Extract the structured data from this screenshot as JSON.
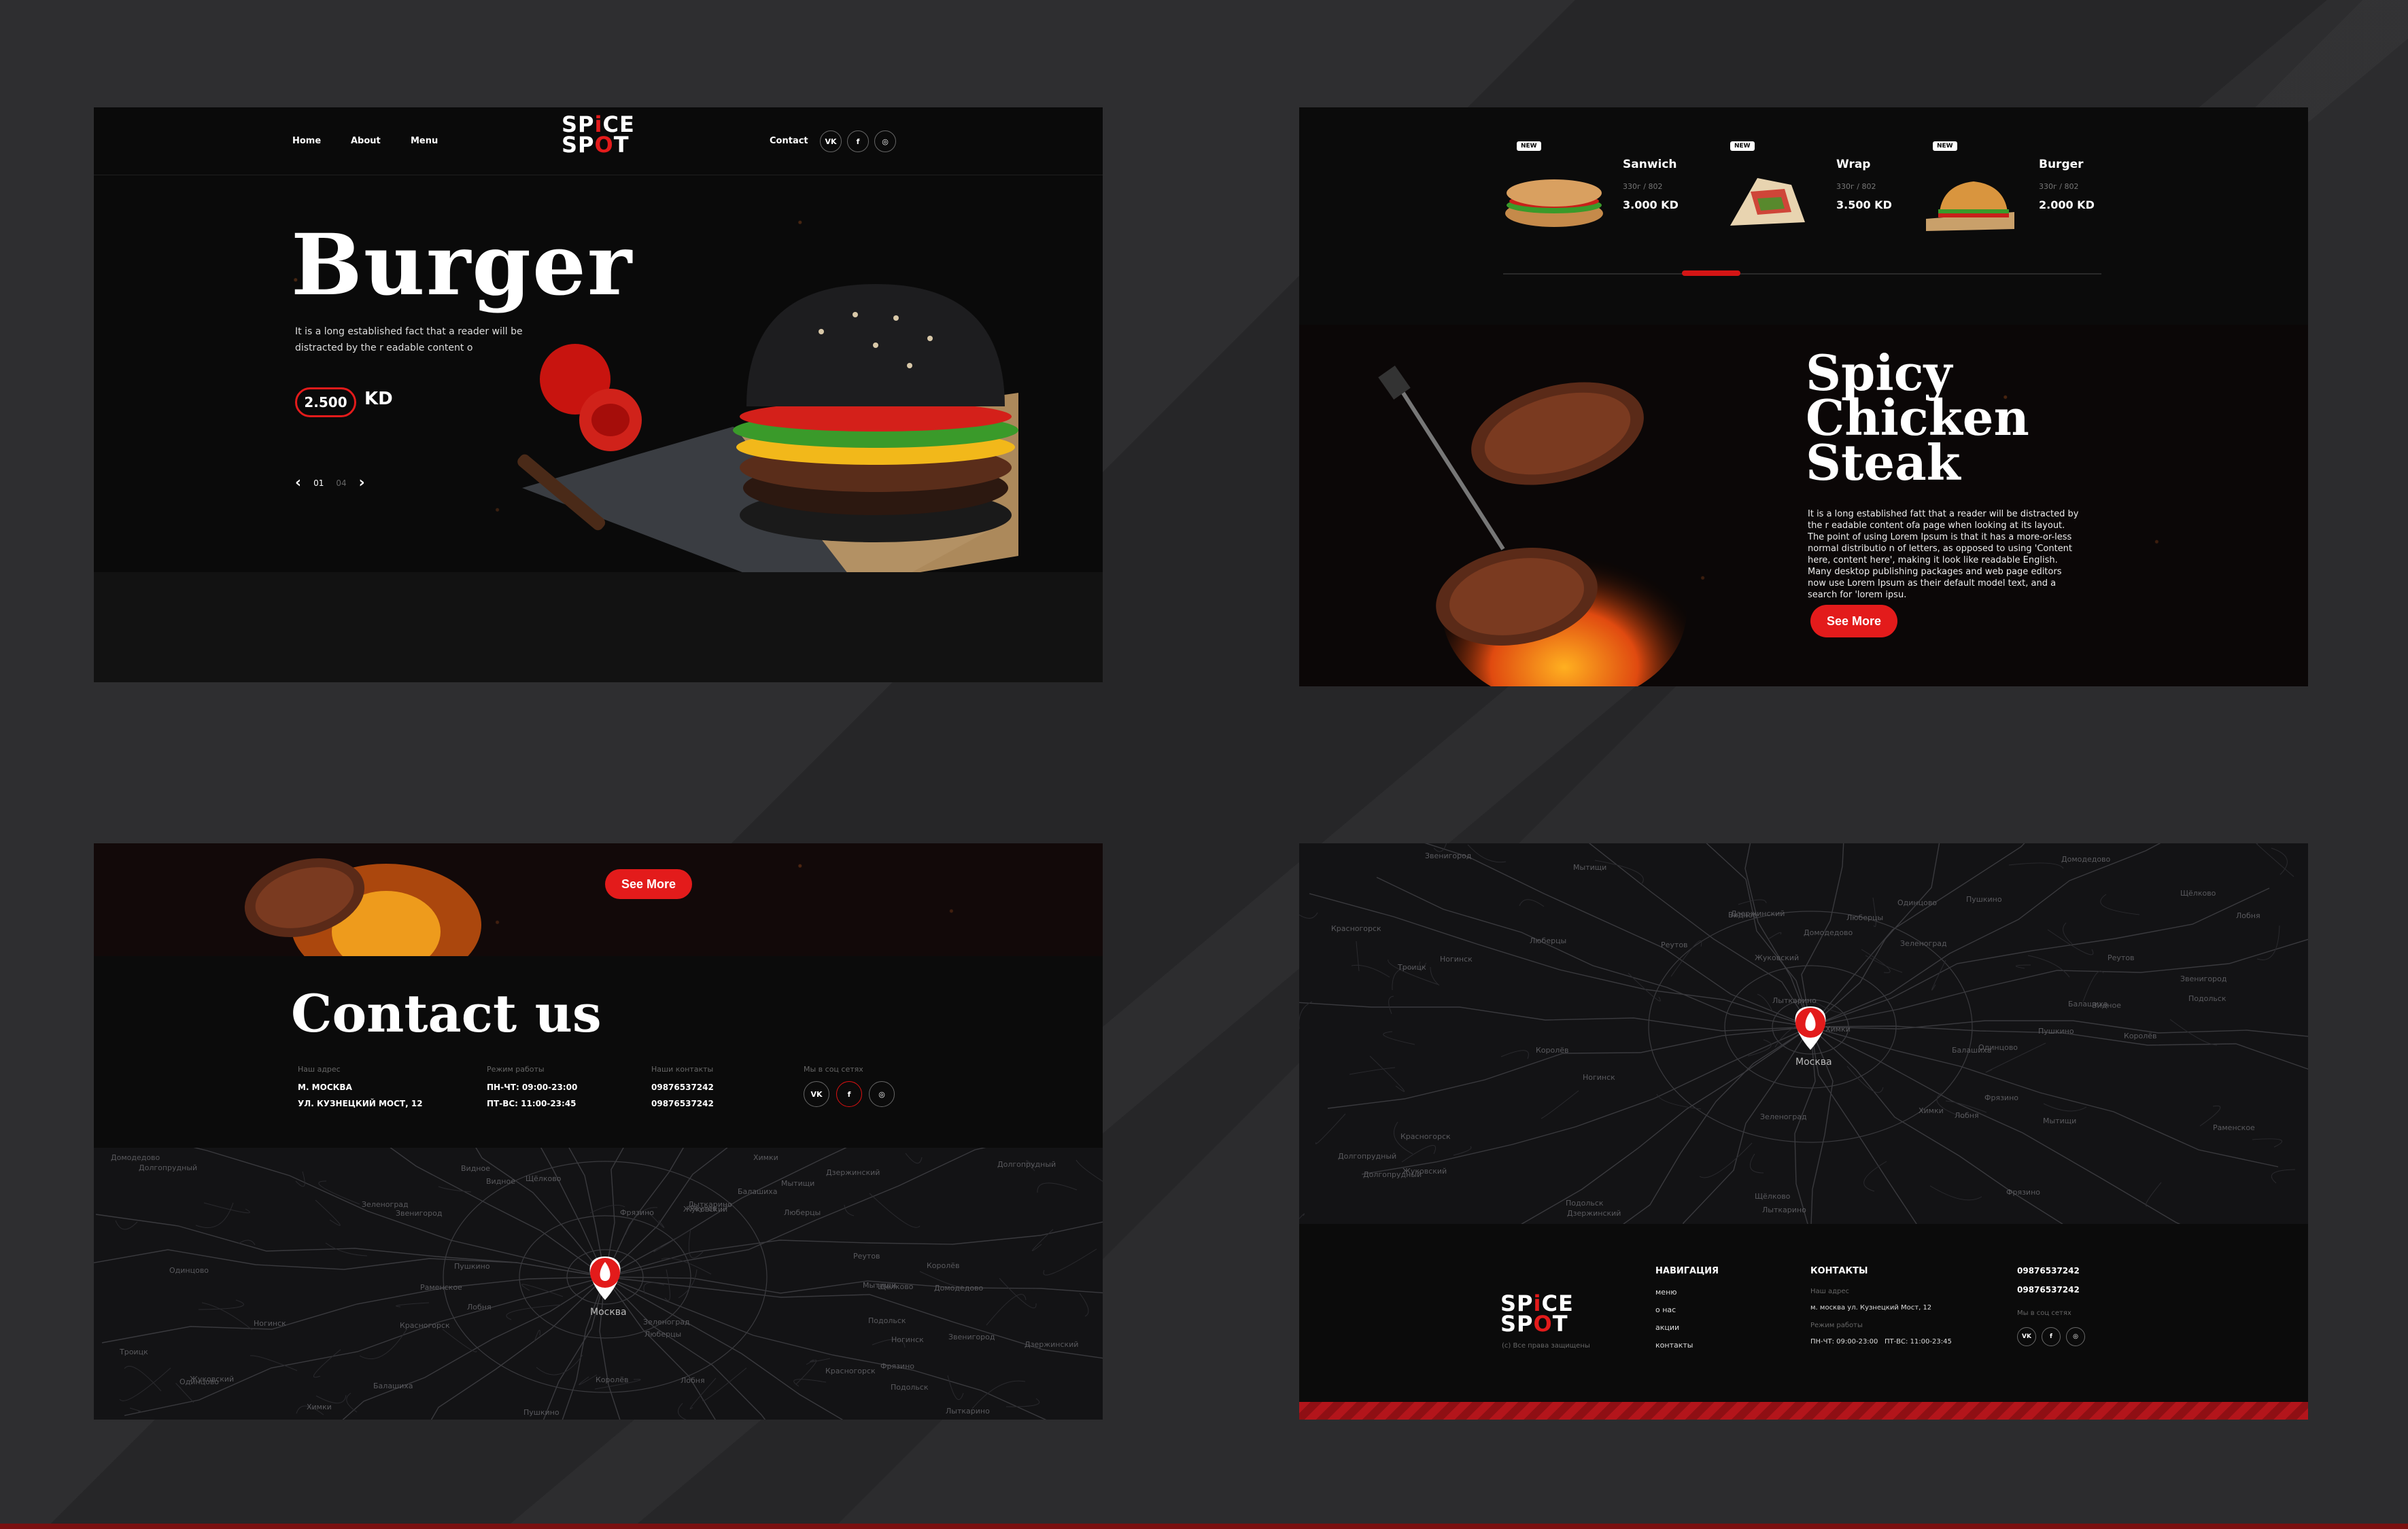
{
  "hero": {
    "nav": {
      "home": "Home",
      "about": "About",
      "menu": "Menu",
      "contact": "Contact"
    },
    "logo": {
      "line1a": "SP",
      "line1b": "i",
      "line1c": "CE",
      "line2a": "SP",
      "line2b": "O",
      "line2c": "T"
    },
    "social": {
      "vk": "VK",
      "fb": "f",
      "ig": "◎"
    },
    "title": "Burger",
    "description": "It is a long established fact that a reader will be distracted by the r eadable content o",
    "price": "2.500",
    "currency": "KD",
    "pager": {
      "current": "01",
      "total": "04"
    }
  },
  "products": {
    "items": [
      {
        "badge": "NEW",
        "name": "Sanwich",
        "weight": "330г / 802",
        "price": "3.000 KD"
      },
      {
        "badge": "NEW",
        "name": "Wrap",
        "weight": "330г / 802",
        "price": "3.500 KD"
      },
      {
        "badge": "NEW",
        "name": "Burger",
        "weight": "330г / 802",
        "price": "2.000 KD"
      }
    ],
    "feature": {
      "title_line1": "Spicy",
      "title_line2": "Chicken",
      "title_line3": "Steak",
      "description": "It is a long established fatt that a reader will be distracted by the r eadable content ofa page when looking at its layout. The point of using Lorem Ipsum is that it has a more-or-less normal distributio n of letters, as opposed to using 'Content here, content here', making it look like readable English. Many desktop publishing packages and web page editors now use Lorem Ipsum as their default model text, and a search for 'lorem ipsu.",
      "button": "See More"
    }
  },
  "contact": {
    "button": "See More",
    "title": "Contact us",
    "address": {
      "label": "Наш адрес",
      "line1": "М. МОСКВА",
      "line2": "УЛ. КУЗНЕЦКИЙ МОСТ, 12"
    },
    "hours": {
      "label": "Режим работы",
      "line1": "ПН-ЧТ: 09:00-23:00",
      "line2": "ПТ-ВС: 11:00-23:45"
    },
    "phones": {
      "label": "Наши контакты",
      "line1": "09876537242",
      "line2": "09876537242"
    },
    "social_label": "Мы в соц сетях",
    "map_city": "Москва"
  },
  "footer": {
    "map_city": "Москва",
    "nav_head": "НАВИГАЦИЯ",
    "nav_items": [
      "меню",
      "о нас",
      "акции",
      "контакты"
    ],
    "contacts_head": "КОНТАКТЫ",
    "address_label": "Наш адрес",
    "address": "м. москва ул. Кузнецкий Мост, 12",
    "hours_label": "Режим работы",
    "hours": "ПН-ЧТ: 09:00-23:00   ПТ-ВС: 11:00-23:45",
    "phone1": "09876537242",
    "phone2": "09876537242",
    "social_label": "Мы в соц сетях",
    "copyright": "(c) Все права защищены"
  },
  "map_towns": [
    "Ногинск",
    "Химки",
    "Мытищи",
    "Пушкино",
    "Королёв",
    "Балашиха",
    "Люберцы",
    "Реутов",
    "Одинцово",
    "Красногорск",
    "Подольск",
    "Видное",
    "Зеленоград",
    "Дзержинский",
    "Лыткарино",
    "Щёлково",
    "Фрязино",
    "Долгопрудный",
    "Лобня",
    "Звенигород",
    "Домодедово",
    "Жуковский",
    "Раменское",
    "Троицк"
  ],
  "colors": {
    "accent": "#e31b1b",
    "panel": "#0b0b0b",
    "frame": "#2a2a2c"
  }
}
